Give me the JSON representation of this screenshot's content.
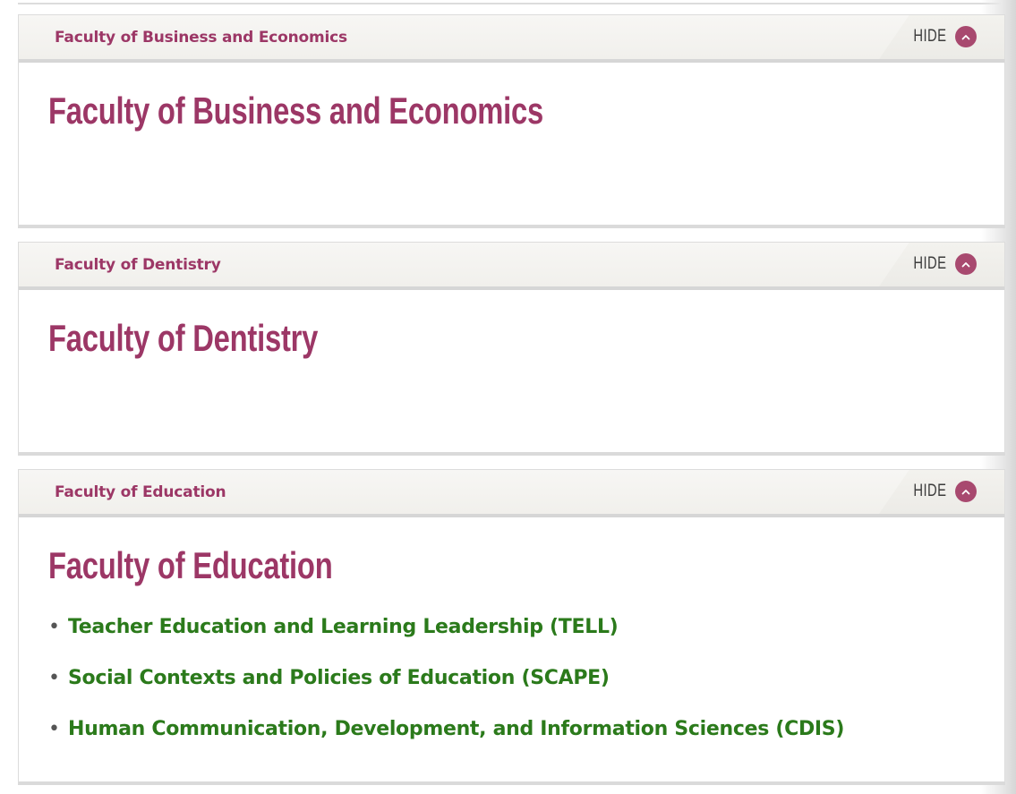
{
  "panels": [
    {
      "header_title": "Faculty of Business and Economics",
      "toggle_label": "HIDE",
      "heading": "Faculty of Business and Economics",
      "links": []
    },
    {
      "header_title": "Faculty of Dentistry",
      "toggle_label": "HIDE",
      "heading": "Faculty of Dentistry",
      "links": []
    },
    {
      "header_title": "Faculty of Education",
      "toggle_label": "HIDE",
      "heading": "Faculty of Education",
      "links": [
        "Teacher Education and Learning Leadership (TELL)",
        "Social Contexts and Policies of Education (SCAPE)",
        "Human Communication, Development, and Information Sciences (CDIS)"
      ]
    }
  ],
  "icons": {
    "toggle": "chevron-up-icon",
    "bullet": "•"
  },
  "colors": {
    "accent": "#9c3766",
    "toggle_circle": "#a8496f",
    "link": "#2b7a1b",
    "header_bg": "#f3f2ee"
  }
}
